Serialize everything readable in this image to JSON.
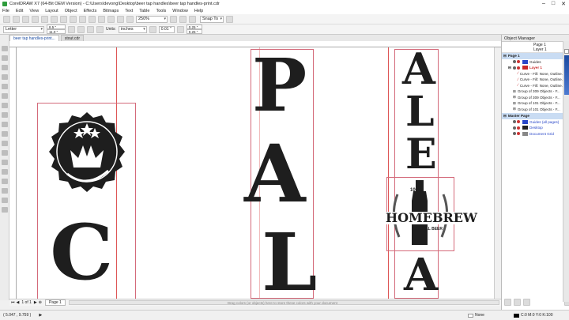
{
  "app": {
    "title": "CorelDRAW X7 (64-Bit OEM Version) - C:\\Users\\devong\\Desktop\\beer tap handles\\beer tap handles-print.cdr"
  },
  "menu": [
    "File",
    "Edit",
    "View",
    "Layout",
    "Object",
    "Effects",
    "Bitmaps",
    "Text",
    "Table",
    "Tools",
    "Window",
    "Help"
  ],
  "toolbar": {
    "zoom": "250%",
    "snap": "Snap To"
  },
  "property_bar": {
    "page_size": "Letter",
    "width": "8.5 \"",
    "height": "11.0 \"",
    "units_label": "Units:",
    "units": "inches",
    "nudge": "0.01 \"",
    "dup_x": "0.25 \"",
    "dup_y": "0.25 \""
  },
  "doc_tabs": [
    {
      "label": "beer tap handles-print..."
    },
    {
      "label": "stout.cdr"
    }
  ],
  "page_nav": {
    "counter": "1 of 1",
    "tab": "Page 1",
    "hint": "Drag colors (or objects) here to store these colors with your document"
  },
  "statusbar": {
    "coords": "( 5.047 , 9.759 )",
    "fill": "None",
    "color_info": "C:0 M:0 Y:0 K:100"
  },
  "artwork": {
    "pale": [
      "P",
      "A",
      "L"
    ],
    "ale": [
      "A",
      "L",
      "E",
      "A"
    ],
    "homebrew_top": "100%",
    "homebrew": "HOMEBREW",
    "homebrew_bottom": "NATURAL BEER",
    "blackletter": "C"
  },
  "object_manager": {
    "title": "Object Manager",
    "header_page": "Page 1",
    "header_layer": "Layer 1",
    "rows": [
      {
        "label": "Page 1",
        "kind": "page"
      },
      {
        "label": "Guides",
        "kind": "layer",
        "color": "#2846c8"
      },
      {
        "label": "Layer 1",
        "kind": "layer-active",
        "color": "#c82828"
      },
      {
        "label": "Curve - Fill: None, Outline...",
        "kind": "curve"
      },
      {
        "label": "Curve - Fill: None, Outline...",
        "kind": "curve"
      },
      {
        "label": "Curve - Fill: None, Outline...",
        "kind": "curve"
      },
      {
        "label": "Group of 309 Objects - F...",
        "kind": "group"
      },
      {
        "label": "Group of 309 Objects - F...",
        "kind": "group"
      },
      {
        "label": "Group of 101 Objects - F...",
        "kind": "group"
      },
      {
        "label": "Group of 101 Objects - F...",
        "kind": "group"
      },
      {
        "label": "Master Page",
        "kind": "page"
      },
      {
        "label": "Guides (all pages)",
        "kind": "master",
        "color": "#2846c8"
      },
      {
        "label": "Desktop",
        "kind": "master",
        "color": "#222222"
      },
      {
        "label": "Document Grid",
        "kind": "master",
        "color": "#888888"
      }
    ]
  },
  "colors": {
    "selection": "#c9dcf3",
    "outline": "#d46a7a",
    "accent": "#1a4aa0"
  }
}
